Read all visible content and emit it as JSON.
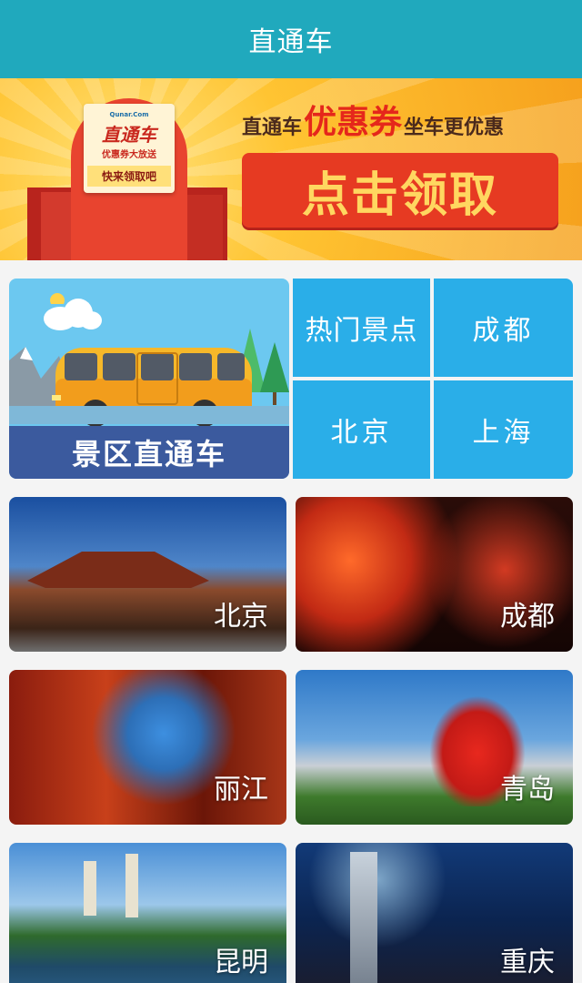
{
  "header": {
    "title": "直通车"
  },
  "banner": {
    "coupon_brand": "Qunar.Com",
    "coupon_title": "直通车",
    "coupon_subtitle": "优惠券大放送",
    "coupon_ribbon": "快来领取吧",
    "slogan_prefix": "直通车",
    "slogan_highlight": "优惠券",
    "slogan_suffix": "坐车更优惠",
    "cta_label": "点击领取"
  },
  "scenic": {
    "card_label": "景区直通车",
    "buttons": [
      "热门景点",
      "成都",
      "北京",
      "上海"
    ]
  },
  "cities": [
    {
      "name": "北京"
    },
    {
      "name": "成都"
    },
    {
      "name": "丽江"
    },
    {
      "name": "青岛"
    },
    {
      "name": "昆明"
    },
    {
      "name": "重庆"
    }
  ],
  "colors": {
    "header_bg": "#20a9bd",
    "tile_blue": "#2aaee8",
    "cta_red": "#e63a22",
    "scenic_label_bg": "#3b5a9e"
  }
}
